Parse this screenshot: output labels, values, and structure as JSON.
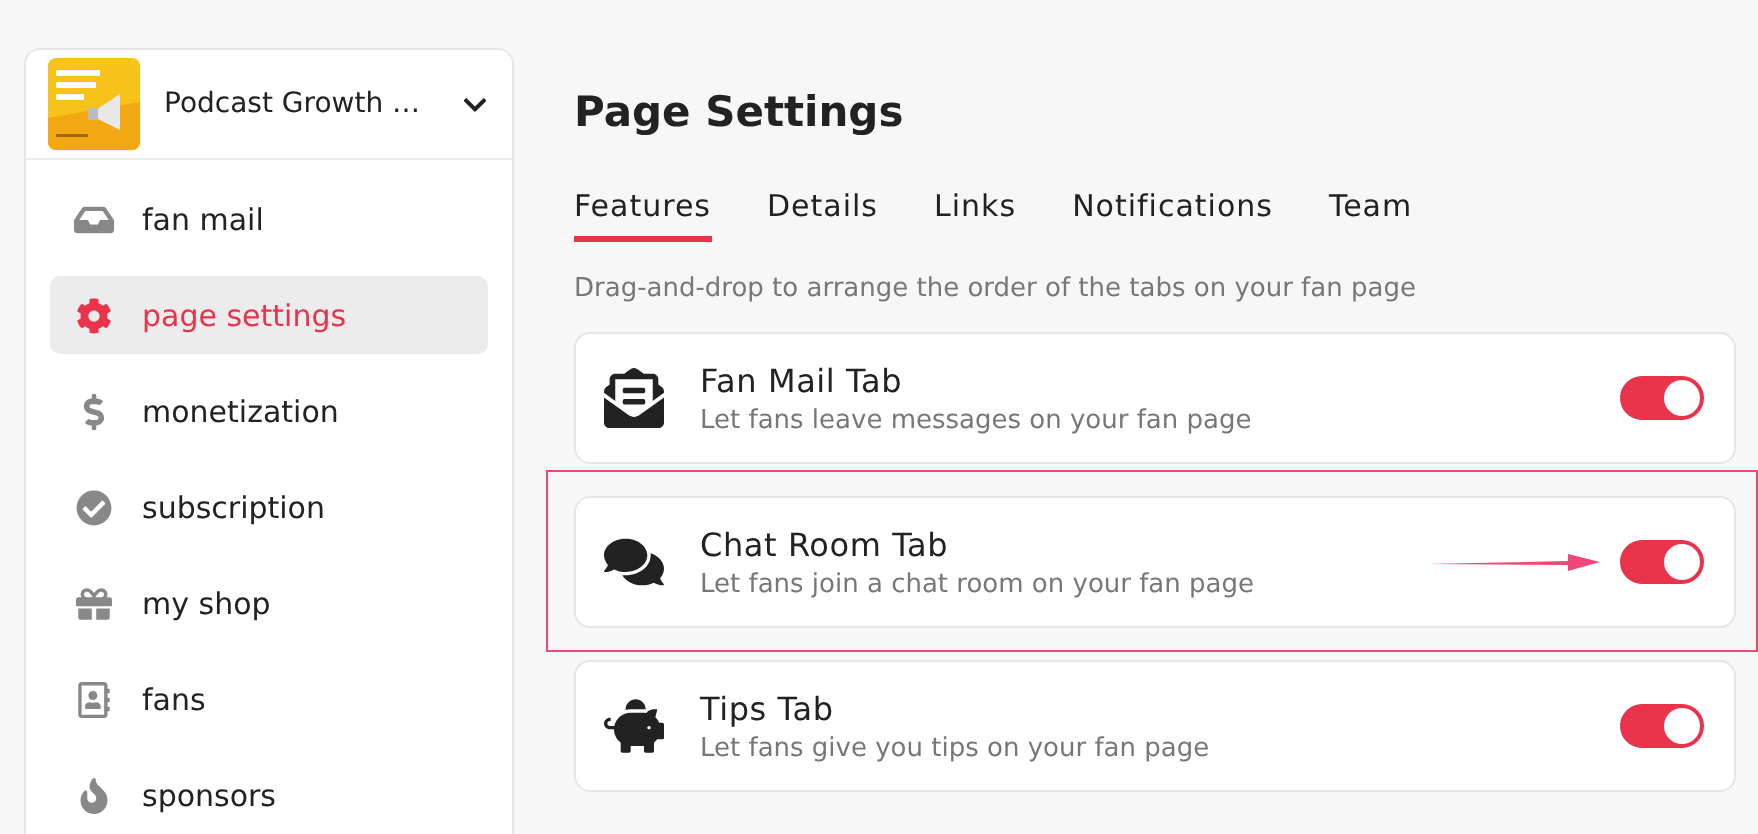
{
  "sidebar": {
    "account": {
      "name": "Podcast Growth …"
    },
    "items": [
      {
        "label": "fan mail",
        "selected": false
      },
      {
        "label": "page settings",
        "selected": true
      },
      {
        "label": "monetization",
        "selected": false
      },
      {
        "label": "subscription",
        "selected": false
      },
      {
        "label": "my shop",
        "selected": false
      },
      {
        "label": "fans",
        "selected": false
      },
      {
        "label": "sponsors",
        "selected": false
      }
    ]
  },
  "main": {
    "title": "Page Settings",
    "tabs": [
      {
        "label": "Features",
        "selected": true
      },
      {
        "label": "Details",
        "selected": false
      },
      {
        "label": "Links",
        "selected": false
      },
      {
        "label": "Notifications",
        "selected": false
      },
      {
        "label": "Team",
        "selected": false
      }
    ],
    "hint": "Drag-and-drop to arrange the order of the tabs on your fan page",
    "features": [
      {
        "title": "Fan Mail Tab",
        "description": "Let fans leave messages on your fan page",
        "on": true,
        "highlighted": false
      },
      {
        "title": "Chat Room Tab",
        "description": "Let fans join a chat room on your fan page",
        "on": true,
        "highlighted": true
      },
      {
        "title": "Tips Tab",
        "description": "Let fans give you tips on your fan page",
        "on": true,
        "highlighted": false
      }
    ]
  }
}
